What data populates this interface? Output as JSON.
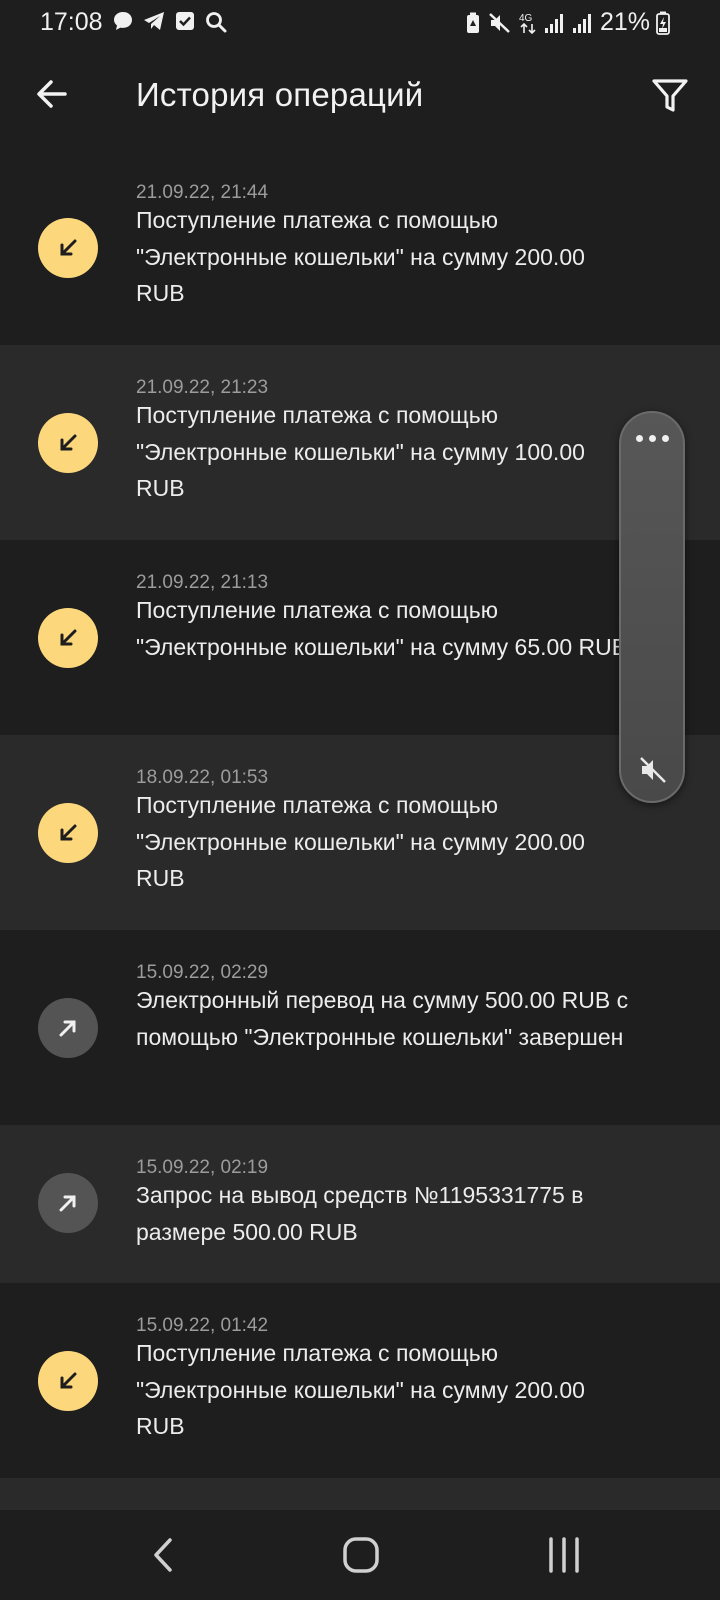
{
  "status_bar": {
    "time": "17:08",
    "battery_percent": "21%",
    "left_icons": [
      "chat-bubble-icon",
      "telegram-icon",
      "checkbox-icon",
      "search-icon"
    ],
    "right_icons": [
      "battery-saver-icon",
      "mute-icon",
      "4g-icon",
      "signal-icon",
      "signal-icon",
      "battery-charging-icon"
    ]
  },
  "app_bar": {
    "title": "История операций",
    "back_icon": "arrow-left-icon",
    "filter_icon": "filter-icon"
  },
  "colors": {
    "background": "#1e1e1e",
    "row_alt": "#2a2a2a",
    "incoming_icon_bg": "#fdd77c",
    "outgoing_icon_bg": "#545454"
  },
  "operations": [
    {
      "date": "21.09.22, 21:44",
      "type": "incoming",
      "description": "Поступление платежа с помощью \"Электронные кошельки\" на сумму 200.00 RUB"
    },
    {
      "date": "21.09.22, 21:23",
      "type": "incoming",
      "description": "Поступление платежа с помощью \"Электронные кошельки\" на сумму 100.00 RUB"
    },
    {
      "date": "21.09.22, 21:13",
      "type": "incoming",
      "description": "Поступление платежа с помощью \"Электронные кошельки\" на сумму 65.00 RUB"
    },
    {
      "date": "18.09.22, 01:53",
      "type": "incoming",
      "description": "Поступление платежа с помощью \"Электронные кошельки\" на сумму 200.00 RUB"
    },
    {
      "date": "15.09.22, 02:29",
      "type": "outgoing",
      "description": "Электронный перевод на сумму 500.00 RUB с помощью \"Электронные кошельки\" завершен"
    },
    {
      "date": "15.09.22, 02:19",
      "type": "outgoing",
      "description": "Запрос на вывод средств №1195331775 в размере 500.00 RUB"
    },
    {
      "date": "15.09.22, 01:42",
      "type": "incoming",
      "description": "Поступление платежа с помощью \"Электронные кошельки\" на сумму 200.00 RUB"
    }
  ],
  "floating_panel": {
    "icons": [
      "more-dots-icon",
      "mute-icon"
    ]
  },
  "nav_bar": {
    "icons": [
      "nav-back-icon",
      "nav-home-icon",
      "nav-recents-icon"
    ]
  }
}
